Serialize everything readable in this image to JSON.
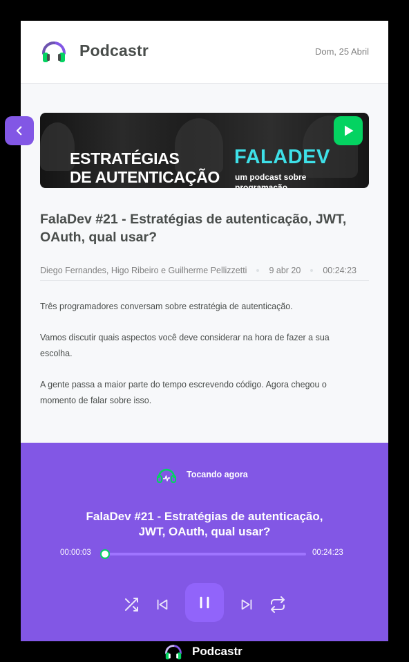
{
  "app": {
    "name": "Podcastr",
    "date": "Dom, 25 Abril"
  },
  "banner": {
    "title_line1": "ESTRATÉGIAS",
    "title_line2": "DE AUTENTICAÇÃO",
    "brand": "FALADEV",
    "subtitle_line1": "um podcast sobre",
    "subtitle_line2": "programação"
  },
  "episode": {
    "title": "FalaDev #21 - Estratégias de autenticação, JWT, OAuth, qual usar?",
    "members": "Diego Fernandes, Higo Ribeiro e Guilherme Pellizzetti",
    "published_at": "9 abr 20",
    "duration": "00:24:23",
    "description": [
      "Três programadores conversam sobre estratégia de autenticação.",
      "Vamos discutir quais aspectos você deve considerar na hora de fazer a sua escolha.",
      "A gente passa a maior parte do tempo escrevendo código. Agora chegou o momento de falar sobre isso."
    ]
  },
  "player": {
    "status_label": "Tocando agora",
    "title_line1": "FalaDev #21 - Estratégias de autenticação,",
    "title_line2": "JWT, OAuth, qual usar?",
    "current_time": "00:00:03",
    "total_time": "00:24:23",
    "progress_fraction": 0.002,
    "is_playing": true
  },
  "dock": {
    "label": "Podcastr"
  },
  "icons": {
    "logo": "headphones-icon",
    "prev_episode": "chevron-left-icon",
    "play_episode": "play-icon",
    "now_playing": "headphones-icon",
    "shuffle": "shuffle-icon",
    "previous": "skip-previous-icon",
    "pause": "pause-icon",
    "next": "skip-next-icon",
    "repeat": "repeat-icon"
  },
  "colors": {
    "purple": "#8257e5",
    "purple_light": "#9164fa",
    "green": "#04d361",
    "text_dark": "#494d4b",
    "text_muted": "#808080"
  }
}
